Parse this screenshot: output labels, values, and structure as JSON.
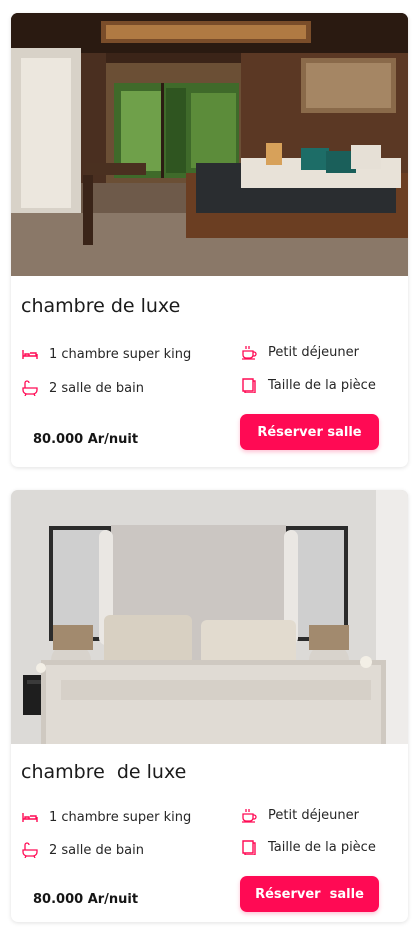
{
  "rooms": [
    {
      "title": "chambre de luxe",
      "features": {
        "bed": "1 chambre super king",
        "bath": "2 salle de bain",
        "breakfast": "Petit déjeuner",
        "size": "Taille de la pièce"
      },
      "price": "80.000 Ar/nuit",
      "book_label": "Réserver salle",
      "icons": {
        "bed": "bed-icon",
        "bath": "bathtub-icon",
        "breakfast": "breakfast-icon",
        "size": "room-size-icon"
      }
    },
    {
      "title": "chambre  de luxe",
      "features": {
        "bed": "1 chambre super king",
        "bath": "2 salle de bain",
        "breakfast": "Petit déjeuner",
        "size": "Taille de la pièce"
      },
      "price": "80.000 Ar/nuit",
      "book_label": "Réserver  salle",
      "icons": {
        "bed": "bed-icon",
        "bath": "bathtub-icon",
        "breakfast": "breakfast-icon",
        "size": "room-size-icon"
      }
    }
  ],
  "colors": {
    "accent": "#ff0a54",
    "text": "#1b1b1b"
  }
}
